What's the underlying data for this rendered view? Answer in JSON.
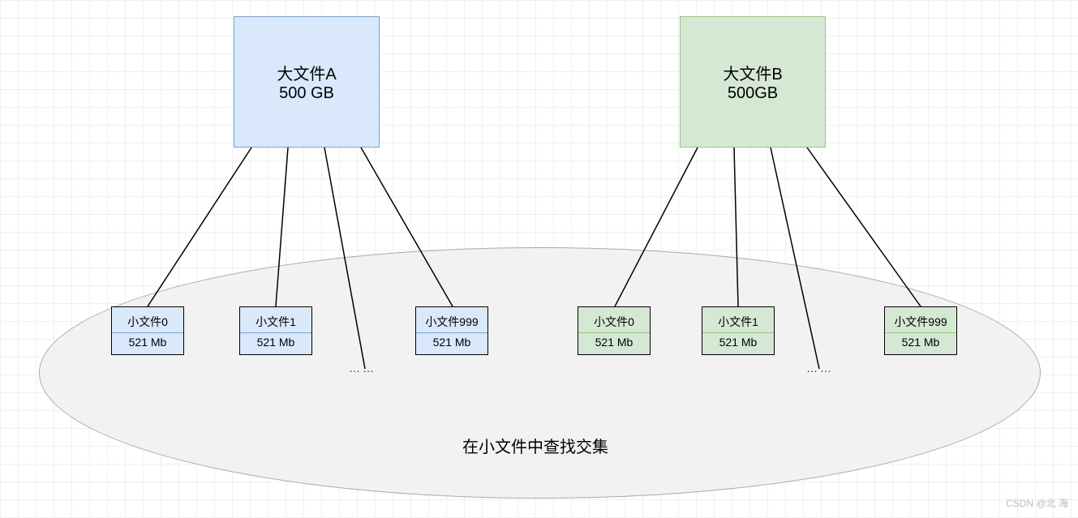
{
  "bigFileA": {
    "title": "大文件A",
    "size": "500 GB"
  },
  "bigFileB": {
    "title": "大文件B",
    "size": "500GB"
  },
  "smallFilesA": [
    {
      "name": "小文件0",
      "size": "521 Mb"
    },
    {
      "name": "小文件1",
      "size": "521 Mb"
    },
    {
      "name": "小文件999",
      "size": "521 Mb"
    }
  ],
  "smallFilesB": [
    {
      "name": "小文件0",
      "size": "521 Mb"
    },
    {
      "name": "小文件1",
      "size": "521 Mb"
    },
    {
      "name": "小文件999",
      "size": "521 Mb"
    }
  ],
  "ellipsis": "……",
  "caption": "在小文件中查找交集",
  "watermark": "CSDN @北   海"
}
